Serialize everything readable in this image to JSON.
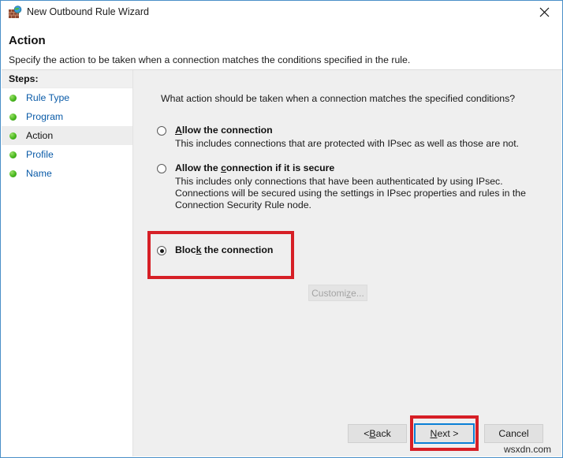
{
  "window": {
    "title": "New Outbound Rule Wizard",
    "icon": "firewall-globe-icon",
    "close_label": "✕",
    "border_color": "#4a90c8"
  },
  "header": {
    "title": "Action",
    "subtitle": "Specify the action to be taken when a connection matches the conditions specified in the rule."
  },
  "sidebar": {
    "header": "Steps:",
    "items": [
      {
        "label": "Rule Type",
        "current": false
      },
      {
        "label": "Program",
        "current": false
      },
      {
        "label": "Action",
        "current": true
      },
      {
        "label": "Profile",
        "current": false
      },
      {
        "label": "Name",
        "current": false
      }
    ]
  },
  "main": {
    "question": "What action should be taken when a connection matches the specified conditions?",
    "options": [
      {
        "id": "allow",
        "label_before": "",
        "accel": "A",
        "label_after": "llow the connection",
        "selected": false,
        "description": "This includes connections that are protected with IPsec as well as those are not."
      },
      {
        "id": "allow-secure",
        "label_before": "Allow the ",
        "accel": "c",
        "label_after": "onnection if it is secure",
        "selected": false,
        "description": "This includes only connections that have been authenticated by using IPsec.  Connections will be secured using the settings in IPsec properties and rules in the Connection Security Rule node."
      },
      {
        "id": "block",
        "label_before": "Bloc",
        "accel": "k",
        "label_after": " the connection",
        "selected": true,
        "description": ""
      }
    ],
    "customize_button": {
      "text_before": "Customi",
      "accel": "z",
      "text_after": "e...",
      "disabled": true
    }
  },
  "footer": {
    "back": {
      "text_before": "< ",
      "accel": "B",
      "text_after": "ack"
    },
    "next": {
      "text_before": "",
      "accel": "N",
      "text_after": "ext >"
    },
    "cancel": {
      "text_before": "Cancel",
      "accel": "",
      "text_after": ""
    }
  },
  "watermark": "wsxdn.com",
  "annotations": {
    "color": "#d61f26",
    "targets": [
      "block-the-connection-option",
      "next-button"
    ]
  }
}
